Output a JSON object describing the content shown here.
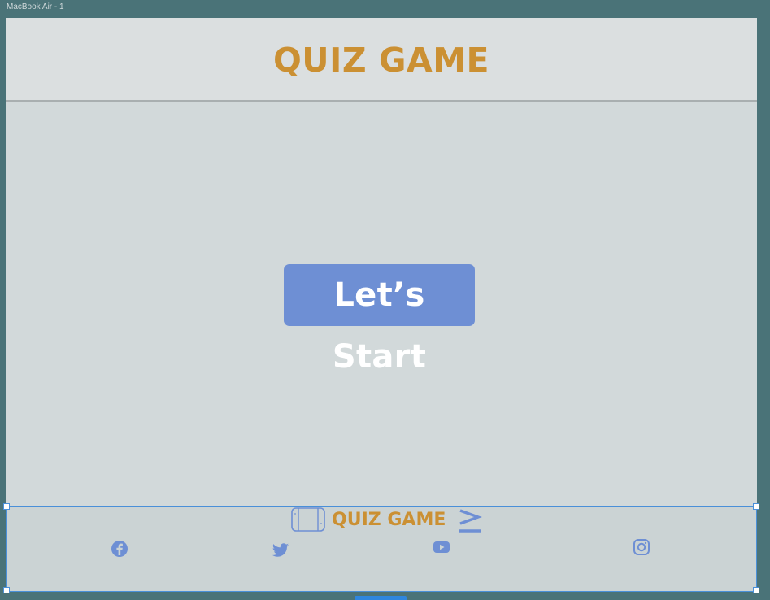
{
  "canvas": {
    "frame_label": "MacBook Air - 1"
  },
  "header": {
    "title": "QUIZ GAME"
  },
  "main": {
    "start_label": "Let’s Start"
  },
  "footer": {
    "title": "QUIZ GAME",
    "social_icons": [
      "facebook-icon",
      "twitter-icon",
      "youtube-icon",
      "instagram-icon"
    ]
  },
  "colors": {
    "title": "#cb9033",
    "button": "#6e8fd4",
    "icon": "#6e8fd4",
    "selection": "#4a90d9"
  }
}
